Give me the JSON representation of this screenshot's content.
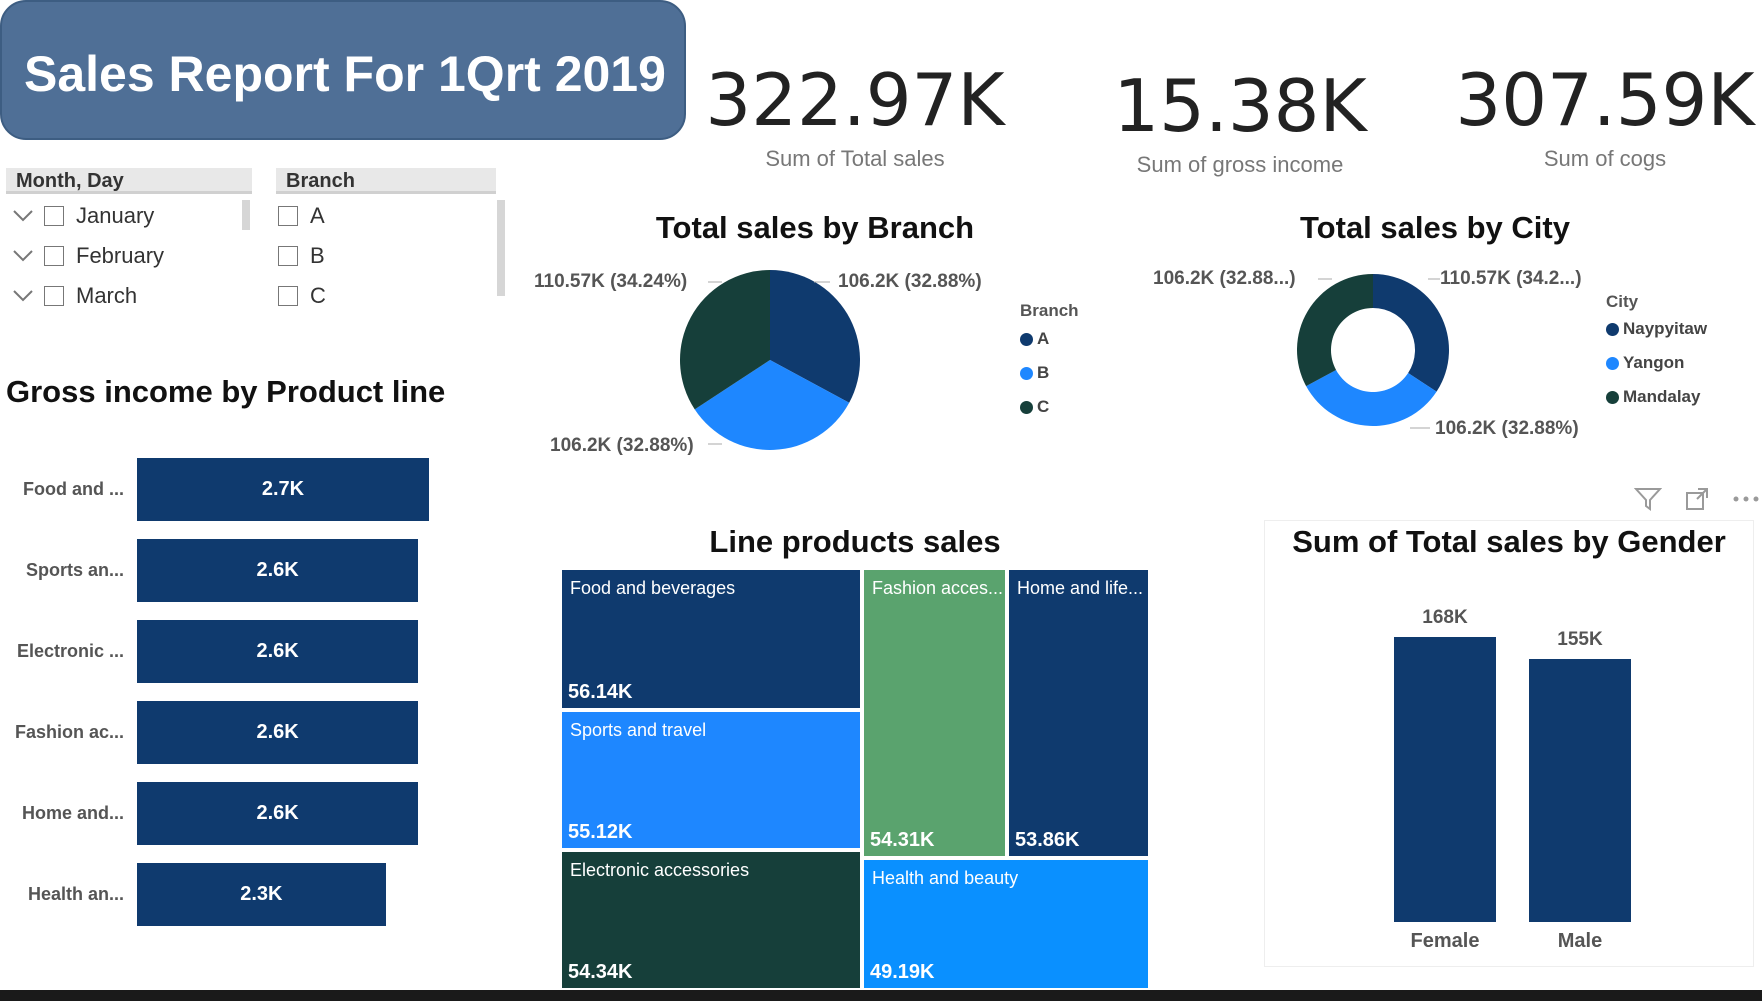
{
  "title": "Sales Report For 1Qrt 2019",
  "kpis": [
    {
      "value": "322.97K",
      "label": "Sum of Total sales"
    },
    {
      "value": "15.38K",
      "label": "Sum of gross income"
    },
    {
      "value": "307.59K",
      "label": "Sum of cogs"
    }
  ],
  "slicers": {
    "month": {
      "header": "Month, Day",
      "items": [
        "January",
        "February",
        "March"
      ]
    },
    "branch": {
      "header": "Branch",
      "items": [
        "A",
        "B",
        "C"
      ]
    }
  },
  "visual_icons": [
    "filter-icon",
    "focus-mode-icon",
    "more-options-icon"
  ],
  "colors": {
    "navy": "#0f3a6e",
    "blue": "#1e87ff",
    "dark_green": "#163f3a",
    "green": "#5aa36e",
    "bright_blue": "#0a90ff"
  },
  "chart_data": [
    {
      "type": "pie",
      "title": "Total sales by Branch",
      "legend_title": "Branch",
      "legend_placement": "right",
      "categories": [
        "A",
        "B",
        "C"
      ],
      "values": [
        106.2,
        106.2,
        110.57
      ],
      "labels": [
        "106.2K (32.88%)",
        "106.2K (32.88%)",
        "110.57K (34.24%)"
      ],
      "colors": [
        "#0f3a6e",
        "#1e87ff",
        "#163f3a"
      ]
    },
    {
      "type": "pie",
      "donut": true,
      "title": "Total sales by City",
      "legend_title": "City",
      "legend_placement": "right",
      "categories": [
        "Naypyitaw",
        "Yangon",
        "Mandalay"
      ],
      "values": [
        110.57,
        106.2,
        106.2
      ],
      "labels": [
        "110.57K (34.2...)",
        "106.2K (32.88%)",
        "106.2K (32.88...)"
      ],
      "colors": [
        "#0f3a6e",
        "#1e87ff",
        "#163f3a"
      ]
    },
    {
      "type": "bar",
      "orientation": "horizontal",
      "title": "Gross income by Product line",
      "categories": [
        "Food and ...",
        "Sports an...",
        "Electronic ...",
        "Fashion ac...",
        "Home and...",
        "Health an..."
      ],
      "values": [
        2.7,
        2.6,
        2.6,
        2.6,
        2.6,
        2.3
      ],
      "data_labels": [
        "2.7K",
        "2.6K",
        "2.6K",
        "2.6K",
        "2.6K",
        "2.3K"
      ]
    },
    {
      "type": "heatmap",
      "subtype": "treemap",
      "title": "Line products sales",
      "categories": [
        "Food and beverages",
        "Sports and travel",
        "Electronic accessories",
        "Fashion acces...",
        "Home and life...",
        "Health and beauty"
      ],
      "values": [
        56.14,
        55.12,
        54.34,
        54.31,
        53.86,
        49.19
      ],
      "data_labels": [
        "56.14K",
        "55.12K",
        "54.34K",
        "54.31K",
        "53.86K",
        "49.19K"
      ],
      "colors": [
        "#0f3a6e",
        "#1e87ff",
        "#163f3a",
        "#5aa36e",
        "#0f3a6e",
        "#0a90ff"
      ]
    },
    {
      "type": "bar",
      "title": "Sum of Total sales by Gender",
      "categories": [
        "Female",
        "Male"
      ],
      "values": [
        168,
        155
      ],
      "data_labels": [
        "168K",
        "155K"
      ],
      "ylim": [
        0,
        168
      ]
    }
  ]
}
